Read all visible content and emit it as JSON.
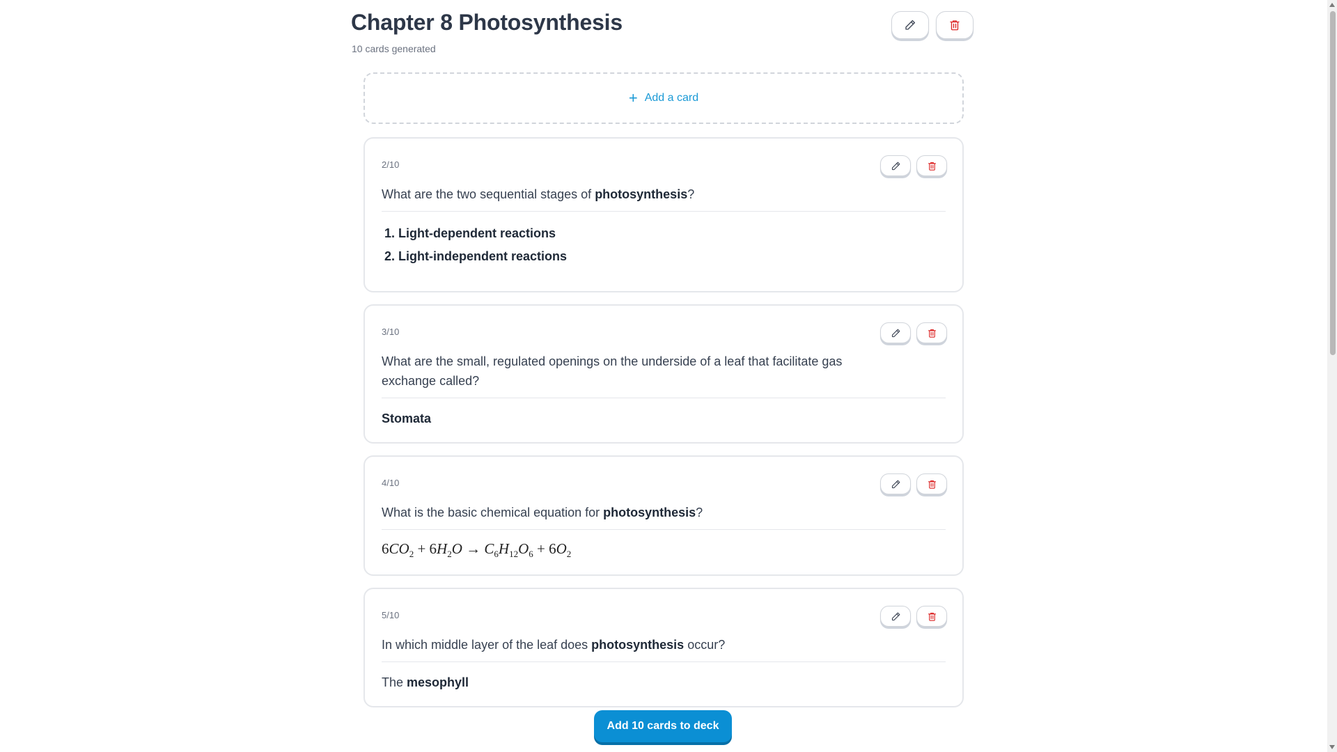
{
  "header": {
    "title": "Chapter 8 Photosynthesis",
    "subtitle": "10 cards generated",
    "edit_icon": "pencil-icon",
    "delete_icon": "trash-icon"
  },
  "add_card": {
    "icon": "plus-icon",
    "label": "Add a card"
  },
  "cards": [
    {
      "counter": "2/10",
      "question_pre": "What are the two sequential stages of ",
      "question_bold": "photosynthesis",
      "question_post": "?",
      "answer_list": [
        "Light-dependent reactions",
        "Light-independent reactions"
      ]
    },
    {
      "counter": "3/10",
      "question": "What are the small, regulated openings on the underside of a leaf that facilitate gas exchange called?",
      "answer_bold": "Stomata"
    },
    {
      "counter": "4/10",
      "question_pre": "What is the basic chemical equation for ",
      "question_bold": "photosynthesis",
      "question_post": "?",
      "equation": "6CO2 + 6H2O → C6H12O6 + 6O2"
    },
    {
      "counter": "5/10",
      "question_pre": "In which middle layer of the leaf does ",
      "question_bold": "photosynthesis",
      "question_post": " occur?",
      "answer_pre": "The ",
      "answer_bold": "mesophyll"
    }
  ],
  "cta": {
    "label": "Add 10 cards to deck"
  },
  "colors": {
    "accent": "#0b8fd4",
    "link": "#1b9ad6",
    "danger": "#dc2626",
    "border": "#e5e7eb"
  }
}
